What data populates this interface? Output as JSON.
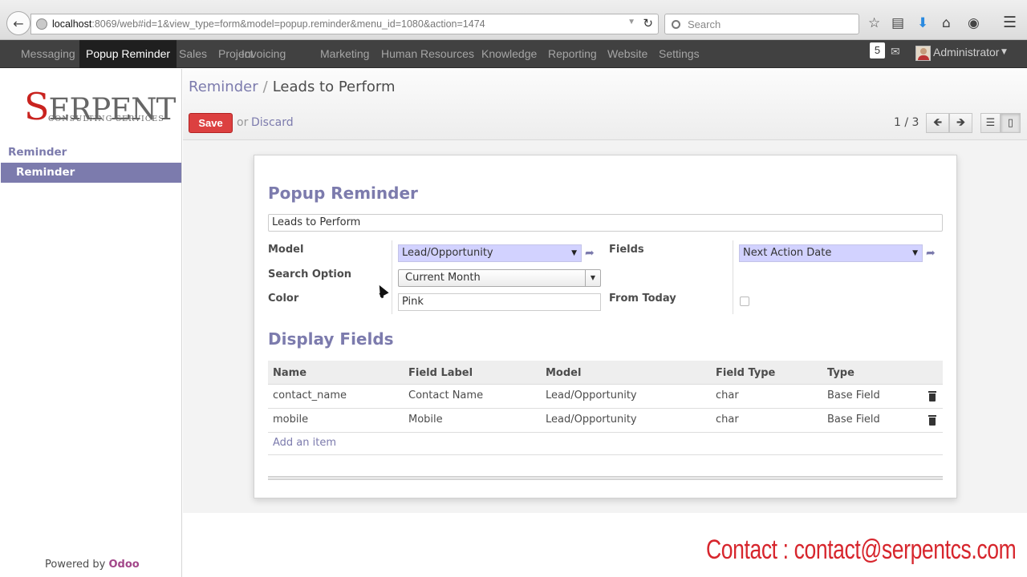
{
  "browser": {
    "url_host": "localhost",
    "url_rest": ":8069/web#id=1&view_type=form&model=popup.reminder&menu_id=1080&action=1474",
    "search_placeholder": "Search"
  },
  "topmenu": {
    "items": [
      "Messaging",
      "Popup Reminder",
      "Sales",
      "Project",
      "Invoicing",
      "Marketing",
      "Human Resources",
      "Knowledge",
      "Reporting",
      "Website",
      "Settings"
    ],
    "active": "Popup Reminder",
    "notification_count": "5",
    "user_name": "Administrator"
  },
  "sidebar": {
    "logo_text": "ERPENT",
    "logo_initial": "S",
    "logo_sub": "CONSULTING SERVICES",
    "section": "Reminder",
    "item": "Reminder",
    "powered_by": "Powered by",
    "powered_brand": "Odoo"
  },
  "control_panel": {
    "breadcrumb_parent": "Reminder",
    "breadcrumb_sep": "/",
    "breadcrumb_current": "Leads to Perform",
    "save_label": "Save",
    "or_text": "or",
    "discard_label": "Discard",
    "pager": "1 / 3"
  },
  "form": {
    "title": "Popup Reminder",
    "name_value": "Leads to Perform",
    "model_label": "Model",
    "model_value": "Lead/Opportunity",
    "fields_label": "Fields",
    "fields_value": "Next Action Date",
    "search_option_label": "Search Option",
    "search_option_value": "Current Month",
    "color_label": "Color",
    "color_value": "Pink",
    "from_today_label": "From Today",
    "from_today_checked": false,
    "display_fields_title": "Display Fields",
    "table_headers": [
      "Name",
      "Field Label",
      "Model",
      "Field Type",
      "Type"
    ],
    "rows": [
      [
        "contact_name",
        "Contact Name",
        "Lead/Opportunity",
        "char",
        "Base Field"
      ],
      [
        "mobile",
        "Mobile",
        "Lead/Opportunity",
        "char",
        "Base Field"
      ]
    ],
    "add_item_label": "Add an item"
  },
  "watermark": "Contact : contact@serpentcs.com",
  "colors": {
    "accent": "#7c7bad",
    "save": "#dc4040",
    "menu_bg": "#414141",
    "watermark": "#d7262d"
  }
}
